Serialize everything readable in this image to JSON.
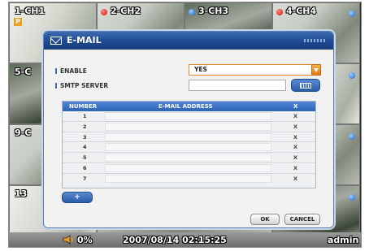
{
  "channels": [
    {
      "label": "1-CH1"
    },
    {
      "label": "2-CH2"
    },
    {
      "label": "3-CH3"
    },
    {
      "label": "4-CH4"
    },
    {
      "label": "5-C"
    },
    {
      "label": "9-C"
    },
    {
      "label": "13"
    }
  ],
  "ch1_badge": "P",
  "status": {
    "volume": "0%",
    "datetime": "2007/08/14  02:15:25",
    "user": "admin"
  },
  "dialog": {
    "title": "E-MAIL",
    "enable_label": "ENABLE",
    "enable_value": "YES",
    "smtp_label": "SMTP SERVER",
    "smtp_value": "",
    "table": {
      "columns": [
        "NUMBER",
        "E-MAIL ADDRESS",
        "X"
      ],
      "rows": [
        {
          "number": "1",
          "address": "",
          "delete": "X"
        },
        {
          "number": "2",
          "address": "",
          "delete": "X"
        },
        {
          "number": "3",
          "address": "",
          "delete": "X"
        },
        {
          "number": "4",
          "address": "",
          "delete": "X"
        },
        {
          "number": "5",
          "address": "",
          "delete": "X"
        },
        {
          "number": "6",
          "address": "",
          "delete": "X"
        },
        {
          "number": "7",
          "address": "",
          "delete": "X"
        }
      ]
    },
    "add_label": "+",
    "ok_label": "OK",
    "cancel_label": "CANCEL"
  },
  "icons": [
    "mail-icon",
    "keyboard-icon",
    "speaker-icon",
    "dropdown-arrow-icon",
    "recording-dot-icon",
    "camera-status-dot-icon"
  ],
  "colors": {
    "title_bar": "#1d4a91",
    "accent_orange": "#e07a15",
    "header_blue": "#2d64b8"
  }
}
